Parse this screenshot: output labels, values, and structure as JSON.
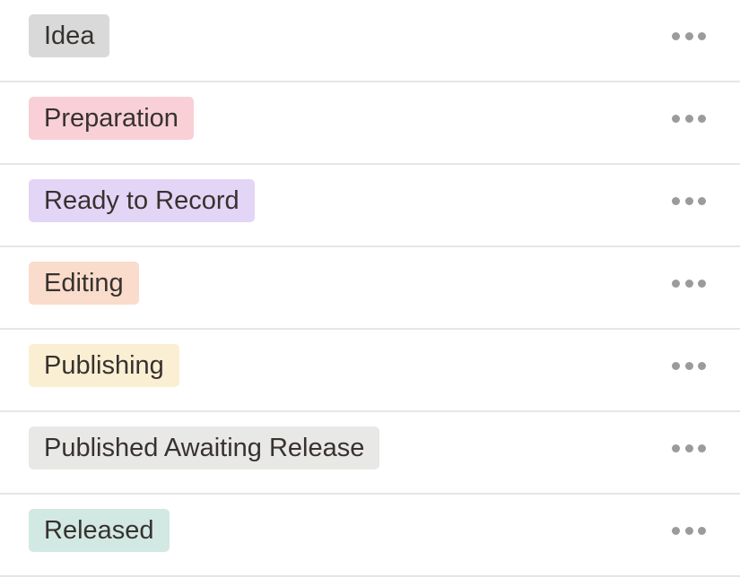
{
  "options": [
    {
      "label": "Idea",
      "color": "#d9d9d9"
    },
    {
      "label": "Preparation",
      "color": "#f8d0d5"
    },
    {
      "label": "Ready to Record",
      "color": "#e3d5f5"
    },
    {
      "label": "Editing",
      "color": "#f9dccc"
    },
    {
      "label": "Publishing",
      "color": "#faefd3"
    },
    {
      "label": "Published Awaiting Release",
      "color": "#e8e8e6"
    },
    {
      "label": "Released",
      "color": "#d2e8e3"
    }
  ],
  "more_icon": "ellipsis-horizontal-icon"
}
